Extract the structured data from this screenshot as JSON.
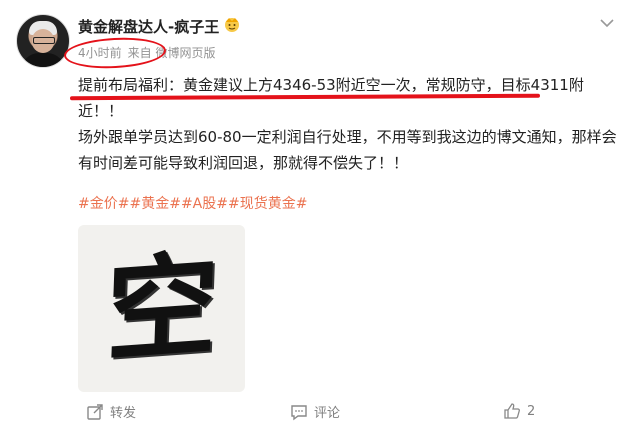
{
  "author": {
    "name": "黄金解盘达人-疯子王",
    "badge_icon": "crown-emoji-icon"
  },
  "meta": {
    "time": "4小时前",
    "source": "来自 微博网页版"
  },
  "post": {
    "line1": "提前布局福利：黄金建议上方4346-53附近空一次，常规防守，目标4311附",
    "line2": "近！！",
    "line3": "场外跟单学员达到60-80一定利润自行处理，不用等到我这边的博文通知，那样会",
    "line4": "有时间差可能导致利润回退，那就得不偿失了！！"
  },
  "hashtags": [
    "#金价#",
    "#黄金#",
    "#A股#",
    "#现货黄金#"
  ],
  "image": {
    "calligraphy_char": "空"
  },
  "actions": {
    "repost": "转发",
    "comment": "评论",
    "like_count": "2"
  },
  "colors": {
    "hashtag": "#eb7350",
    "annotation": "#e4121a"
  }
}
